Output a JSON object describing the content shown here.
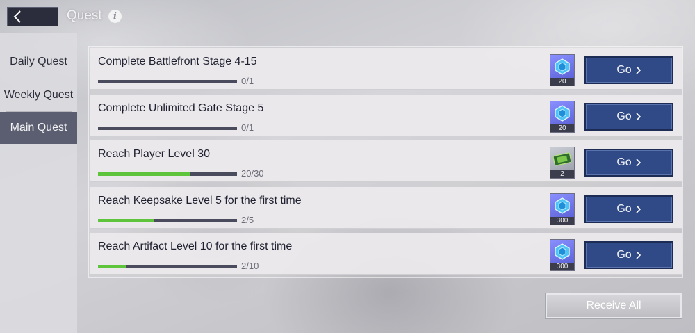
{
  "header": {
    "title": "Quest",
    "info_glyph": "i",
    "back_icon": "chevron-left-icon"
  },
  "sidebar": {
    "items": [
      {
        "label": "Daily Quest",
        "active": false
      },
      {
        "label": "Weekly Quest",
        "active": false
      },
      {
        "label": "Main Quest",
        "active": true
      }
    ]
  },
  "quests": [
    {
      "title": "Complete Battlefront Stage 4-15",
      "progress_text": "0/1",
      "progress": 0.0,
      "reward_icon": "blue-crystal-icon",
      "reward_count": "20",
      "go_label": "Go"
    },
    {
      "title": "Complete Unlimited Gate Stage 5",
      "progress_text": "0/1",
      "progress": 0.0,
      "reward_icon": "blue-crystal-icon",
      "reward_count": "20",
      "go_label": "Go"
    },
    {
      "title": "Reach Player Level 30",
      "progress_text": "20/30",
      "progress": 0.667,
      "reward_icon": "green-ticket-icon",
      "reward_count": "2",
      "go_label": "Go"
    },
    {
      "title": "Reach Keepsake Level 5 for the first time",
      "progress_text": "2/5",
      "progress": 0.4,
      "reward_icon": "blue-crystal-icon",
      "reward_count": "300",
      "go_label": "Go"
    },
    {
      "title": "Reach Artifact Level 10 for the first time",
      "progress_text": "2/10",
      "progress": 0.2,
      "reward_icon": "blue-crystal-icon",
      "reward_count": "300",
      "go_label": "Go"
    }
  ],
  "footer": {
    "receive_all_label": "Receive All"
  },
  "colors": {
    "accent_button": "#2f4a86",
    "progress_fill": "#5ec43c",
    "progress_track": "#4a4b5c",
    "active_tab": "#5b5e70"
  }
}
